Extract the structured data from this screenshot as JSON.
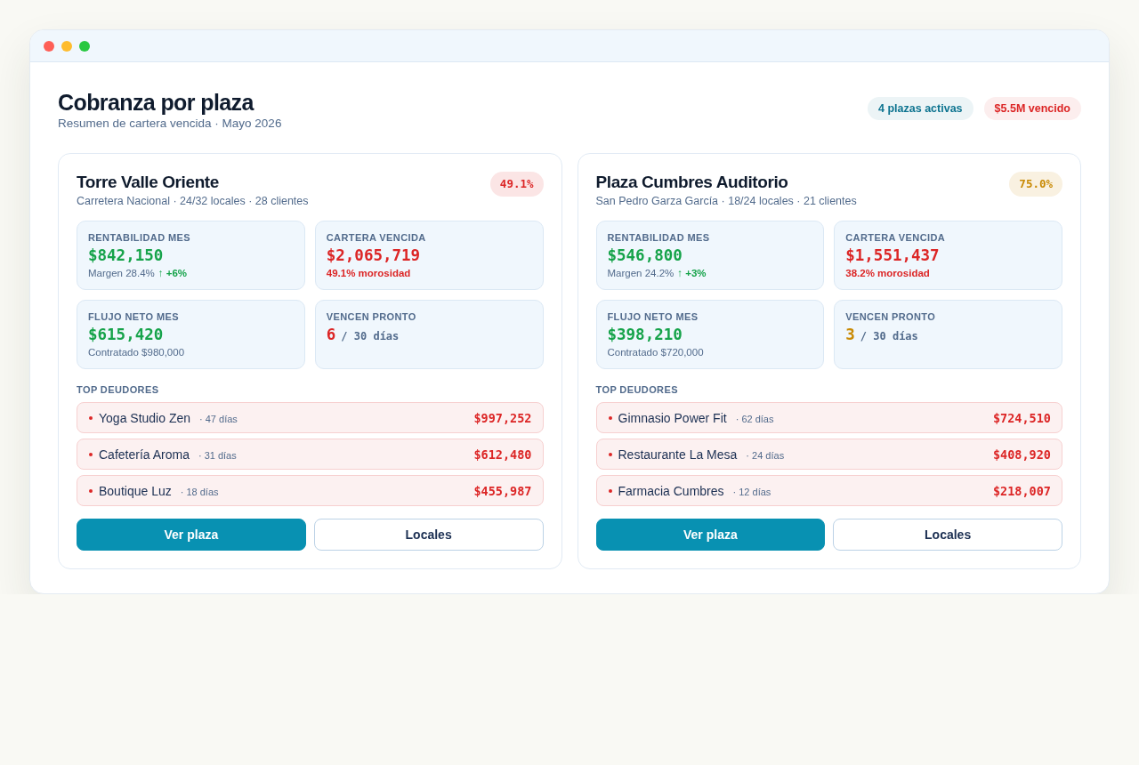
{
  "header": {
    "title": "Cobranza por plaza",
    "subtitle": "Resumen de cartera vencida · Mayo 2026",
    "badges": [
      {
        "label": "4 plazas activas",
        "color": "#0e7490"
      },
      {
        "label": "$5.5M vencido",
        "color": "#dc2626"
      }
    ]
  },
  "plazas": [
    {
      "name": "Torre Valle Oriente",
      "details": "Carretera Nacional · 24/32 locales · 28 clientes",
      "rate": {
        "value": "49.1%",
        "color": "#dc2626"
      },
      "metrics": [
        {
          "kind": "amount",
          "label": "RENTABILIDAD MES",
          "value": "$842,150",
          "color": "#16a34a",
          "note": "Margen 28.4%",
          "note_emphasis": false,
          "trend": "↑ +6%"
        },
        {
          "kind": "amount",
          "label": "CARTERA VENCIDA",
          "value": "$2,065,719",
          "color": "#dc2626",
          "note": "49.1% morosidad",
          "note_emphasis": true
        },
        {
          "kind": "amount",
          "label": "FLUJO NETO MES",
          "value": "$615,420",
          "color": "#16a34a",
          "note": "Contratado $980,000",
          "note_emphasis": false
        },
        {
          "kind": "count",
          "label": "VENCEN PRONTO",
          "value": "6",
          "color": "#dc2626",
          "unit": "/ 30 días"
        }
      ],
      "debtors_title": "TOP DEUDORES",
      "debtors": [
        {
          "name": "Yoga Studio Zen",
          "days": "· 47 días",
          "amount": "$997,252"
        },
        {
          "name": "Cafetería Aroma",
          "days": "· 31 días",
          "amount": "$612,480"
        },
        {
          "name": "Boutique Luz",
          "days": "· 18 días",
          "amount": "$455,987"
        }
      ],
      "actions": [
        {
          "label": "Ver plaza",
          "kind": "primary"
        },
        {
          "label": "Locales",
          "kind": "secondary"
        }
      ]
    },
    {
      "name": "Plaza Cumbres Auditorio",
      "details": "San Pedro Garza García · 18/24 locales · 21 clientes",
      "rate": {
        "value": "75.0%",
        "color": "#c98a04"
      },
      "metrics": [
        {
          "kind": "amount",
          "label": "RENTABILIDAD MES",
          "value": "$546,800",
          "color": "#16a34a",
          "note": "Margen 24.2%",
          "note_emphasis": false,
          "trend": "↑ +3%"
        },
        {
          "kind": "amount",
          "label": "CARTERA VENCIDA",
          "value": "$1,551,437",
          "color": "#dc2626",
          "note": "38.2% morosidad",
          "note_emphasis": true
        },
        {
          "kind": "amount",
          "label": "FLUJO NETO MES",
          "value": "$398,210",
          "color": "#16a34a",
          "note": "Contratado $720,000",
          "note_emphasis": false
        },
        {
          "kind": "count",
          "label": "VENCEN PRONTO",
          "value": "3",
          "color": "#c98a04",
          "unit": "/ 30 días"
        }
      ],
      "debtors_title": "TOP DEUDORES",
      "debtors": [
        {
          "name": "Gimnasio Power Fit",
          "days": "· 62 días",
          "amount": "$724,510"
        },
        {
          "name": "Restaurante La Mesa",
          "days": "· 24 días",
          "amount": "$408,920"
        },
        {
          "name": "Farmacia Cumbres",
          "days": "· 12 días",
          "amount": "$218,007"
        }
      ],
      "actions": [
        {
          "label": "Ver plaza",
          "kind": "primary"
        },
        {
          "label": "Locales",
          "kind": "secondary"
        }
      ]
    }
  ]
}
